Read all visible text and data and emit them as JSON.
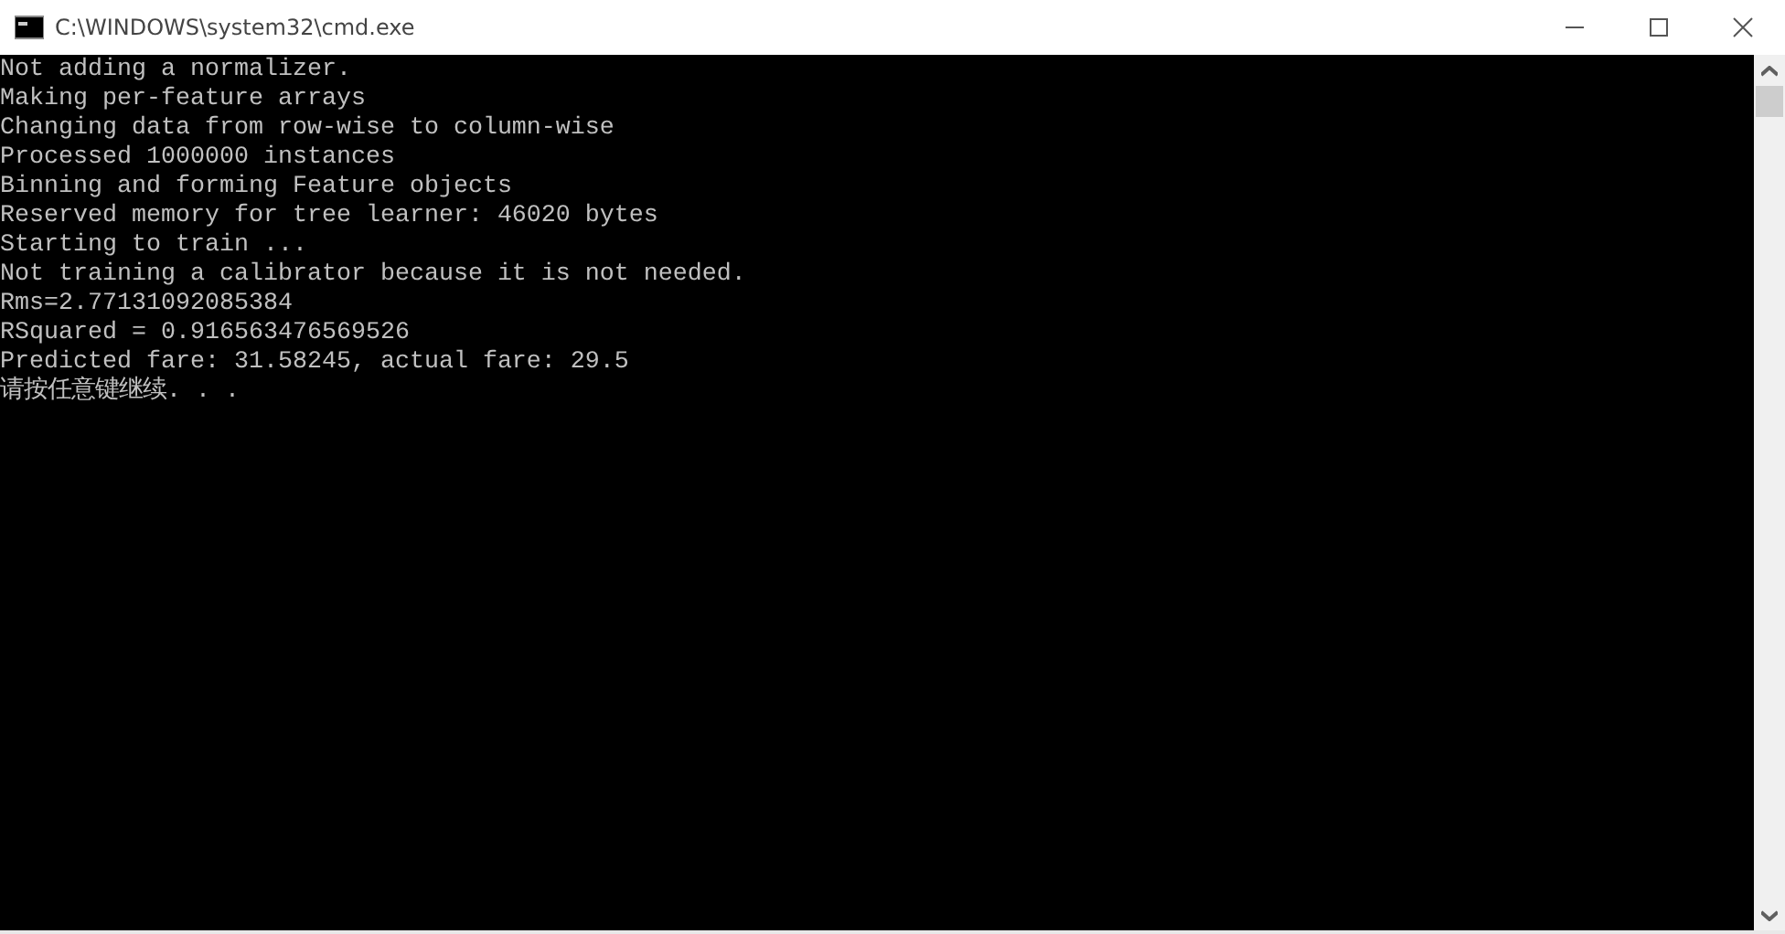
{
  "window": {
    "title": "C:\\WINDOWS\\system32\\cmd.exe"
  },
  "console": {
    "lines": [
      "Not adding a normalizer.",
      "Making per-feature arrays",
      "Changing data from row-wise to column-wise",
      "Processed 1000000 instances",
      "Binning and forming Feature objects",
      "Reserved memory for tree learner: 46020 bytes",
      "Starting to train ...",
      "Not training a calibrator because it is not needed.",
      "Rms=2.77131092085384",
      "RSquared = 0.916563476569526",
      "Predicted fare: 31.58245, actual fare: 29.5",
      "请按任意键继续. . ."
    ]
  }
}
